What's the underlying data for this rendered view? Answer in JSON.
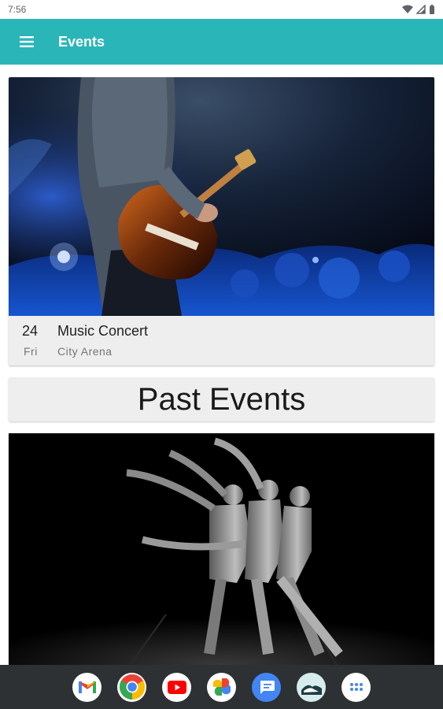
{
  "status_bar": {
    "time": "7:56"
  },
  "app_bar": {
    "title": "Events"
  },
  "upcoming_event": {
    "day": "24",
    "weekday": "Fri",
    "title": "Music Concert",
    "venue": "City Arena"
  },
  "past_events": {
    "heading": "Past Events"
  },
  "dock": {
    "apps": [
      "gmail-icon",
      "chrome-icon",
      "youtube-icon",
      "photos-icon",
      "messages-icon",
      "gallery-icon",
      "app-drawer-icon"
    ]
  },
  "colors": {
    "app_bar": "#2ab5b8",
    "card_background": "#eeeeee",
    "nav_bar": "#2d3134"
  }
}
